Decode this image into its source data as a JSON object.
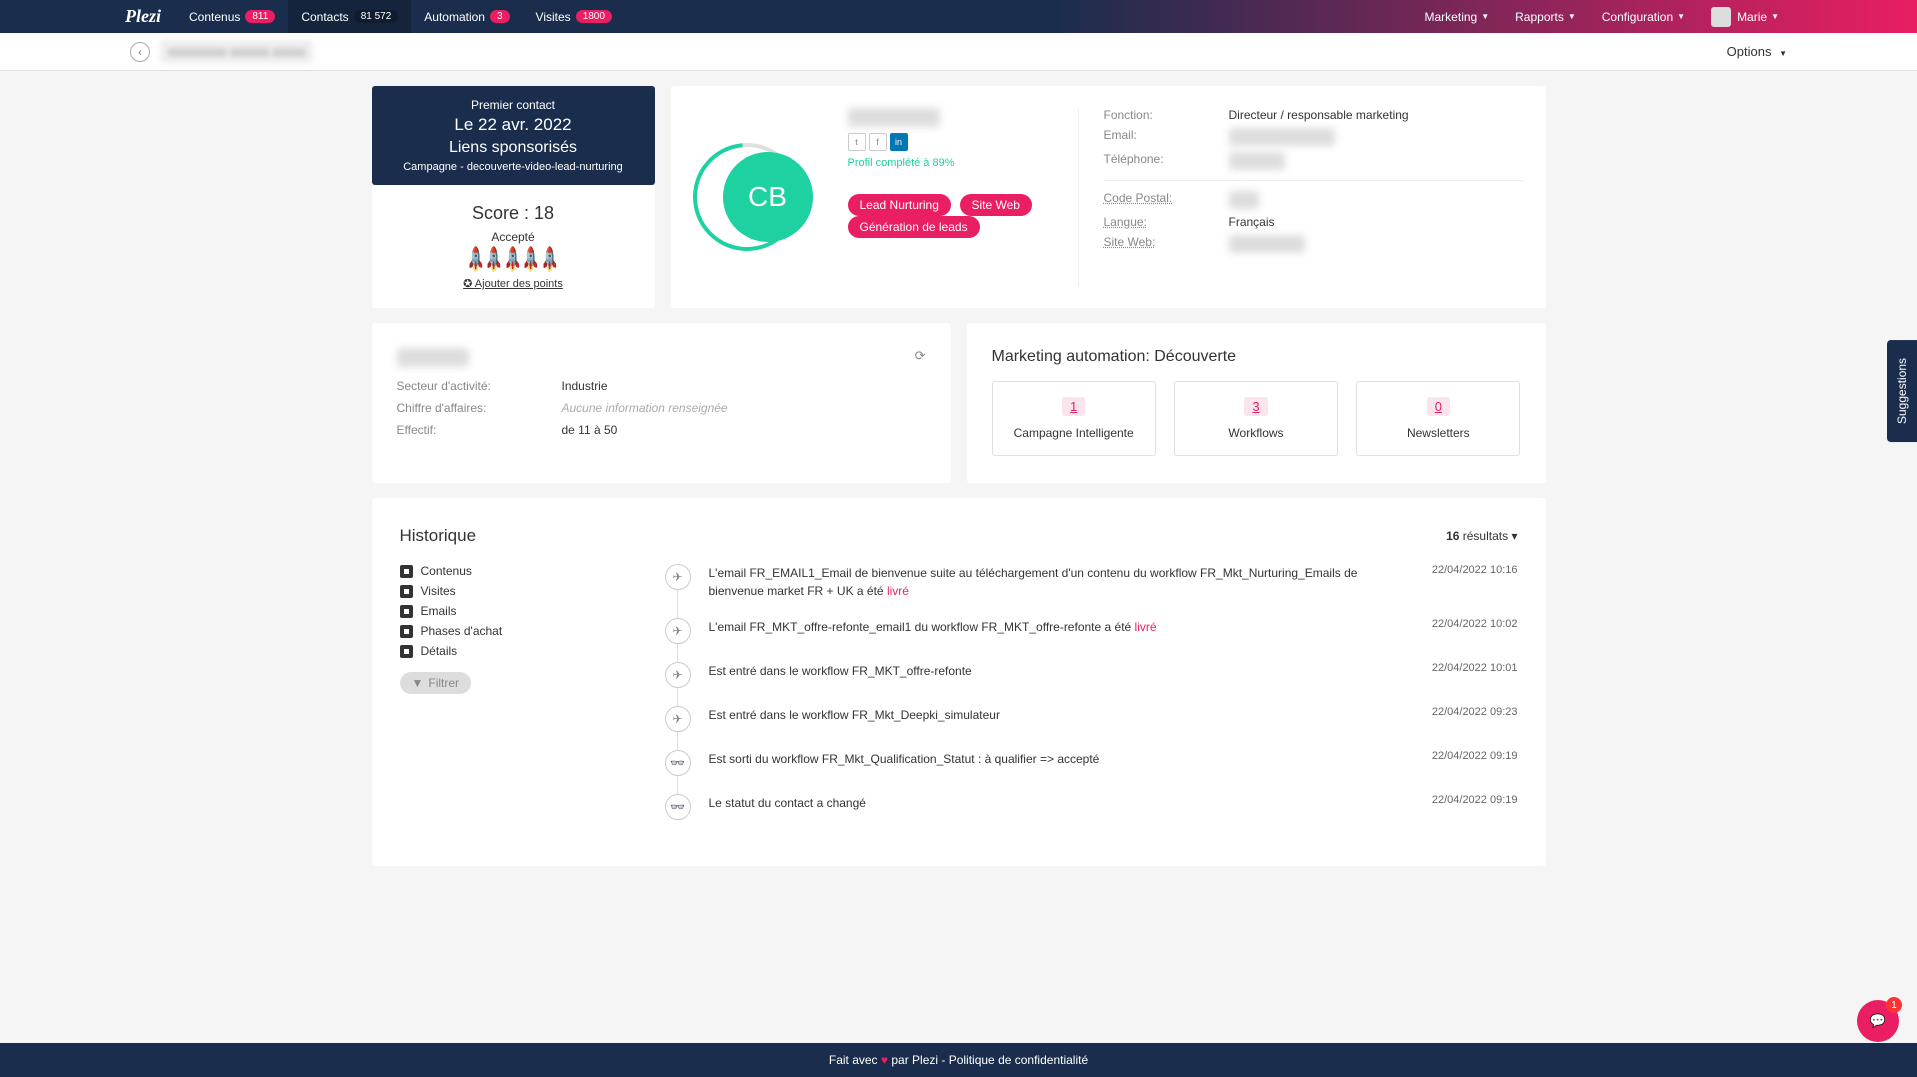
{
  "nav": {
    "brand": "Plezi",
    "items": [
      {
        "label": "Contenus",
        "badge": "811"
      },
      {
        "label": "Contacts",
        "badge": "81 572",
        "active": true
      },
      {
        "label": "Automation",
        "badge": "3"
      },
      {
        "label": "Visites",
        "badge": "1800"
      }
    ],
    "right": [
      {
        "label": "Marketing"
      },
      {
        "label": "Rapports"
      },
      {
        "label": "Configuration"
      }
    ],
    "user": "Marie"
  },
  "subheader": {
    "options": "Options"
  },
  "firstContact": {
    "title": "Premier contact",
    "date": "Le 22 avr. 2022",
    "source": "Liens sponsorisés",
    "campaign": "Campagne - decouverte-video-lead-nurturing"
  },
  "score": {
    "label": "Score : 18",
    "status": "Accepté",
    "addPoints": "Ajouter des points"
  },
  "contact": {
    "initials": "CB",
    "completion": "Profil complété à 89%",
    "tags": [
      "Lead Nurturing",
      "Site Web",
      "Génération de leads"
    ]
  },
  "details": [
    {
      "label": "Fonction:",
      "value": "Directeur / responsable marketing"
    },
    {
      "label": "Email:",
      "value": "",
      "blur": true
    },
    {
      "label": "Téléphone:",
      "value": "",
      "blur": true
    }
  ],
  "details2": [
    {
      "label": "Code Postal:",
      "value": "",
      "blur": true,
      "u": true
    },
    {
      "label": "Langue:",
      "value": "Français",
      "u": true
    },
    {
      "label": "Site Web:",
      "value": "",
      "blur": true,
      "u": true
    }
  ],
  "company": {
    "fields": [
      {
        "label": "Secteur d'activité:",
        "value": "Industrie"
      },
      {
        "label": "Chiffre d'affaires:",
        "value": "Aucune information renseignée",
        "empty": true
      },
      {
        "label": "Effectif:",
        "value": "de 11 à 50"
      }
    ]
  },
  "automation": {
    "title": "Marketing automation: Découverte",
    "boxes": [
      {
        "count": "1",
        "label": "Campagne Intelligente"
      },
      {
        "count": "3",
        "label": "Workflows"
      },
      {
        "count": "0",
        "label": "Newsletters"
      }
    ]
  },
  "history": {
    "title": "Historique",
    "count": "16",
    "countLabel": "résultats",
    "filters": [
      "Contenus",
      "Visites",
      "Emails",
      "Phases d'achat",
      "Détails"
    ],
    "filterBtn": "Filtrer",
    "items": [
      {
        "icon": "plane",
        "text": "L'email FR_EMAIL1_Email de bienvenue suite au téléchargement d'un contenu du workflow FR_Mkt_Nurturing_Emails de bienvenue market FR + UK a été ",
        "status": "livré",
        "date": "22/04/2022 10:16"
      },
      {
        "icon": "plane",
        "text": "L'email FR_MKT_offre-refonte_email1 du workflow FR_MKT_offre-refonte a été ",
        "status": "livré",
        "date": "22/04/2022 10:02"
      },
      {
        "icon": "plane",
        "text": "Est entré dans le workflow FR_MKT_offre-refonte",
        "date": "22/04/2022 10:01"
      },
      {
        "icon": "plane",
        "text": "Est entré dans le workflow FR_Mkt_Deepki_simulateur",
        "date": "22/04/2022 09:23"
      },
      {
        "icon": "binoc",
        "text": "Est sorti du workflow FR_Mkt_Qualification_Statut : à qualifier => accepté",
        "date": "22/04/2022 09:19"
      },
      {
        "icon": "binoc",
        "text": "Le statut du contact a changé",
        "date": "22/04/2022 09:19"
      }
    ]
  },
  "footer": {
    "prefix": "Fait avec ",
    "mid": " par Plezi - ",
    "policy": "Politique de confidentialité"
  },
  "suggestions": "Suggestions",
  "chatBadge": "1"
}
